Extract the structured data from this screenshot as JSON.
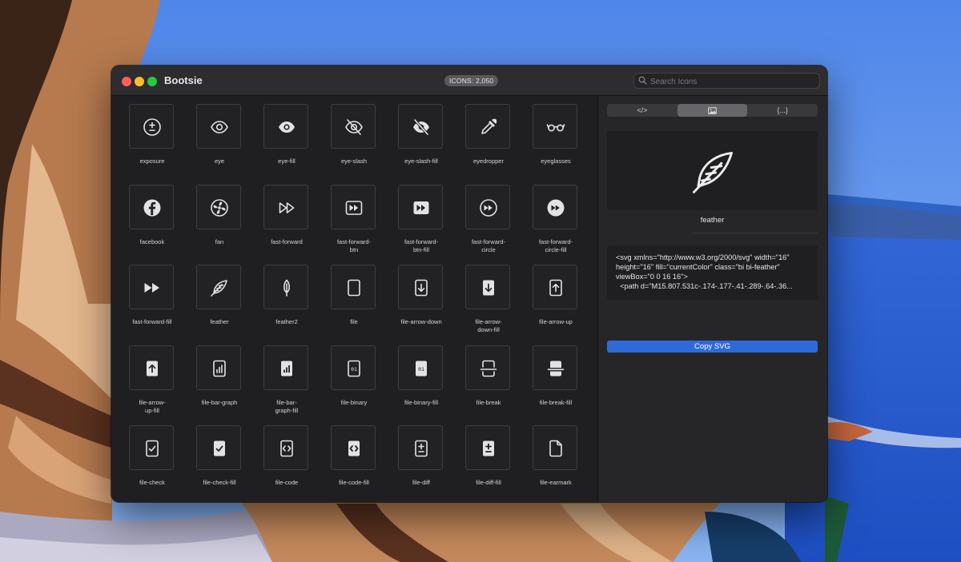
{
  "window": {
    "title": "Bootsie",
    "icon_count": "ICONS: 2,050"
  },
  "search": {
    "placeholder": "Search Icons",
    "value": ""
  },
  "grid": {
    "icons": [
      {
        "name": "exposure",
        "label": [
          "exposure"
        ],
        "icon": "exposure-icon"
      },
      {
        "name": "eye",
        "label": [
          "eye"
        ],
        "icon": "eye-icon"
      },
      {
        "name": "eye-fill",
        "label": [
          "eye-fill"
        ],
        "icon": "eye-fill-icon"
      },
      {
        "name": "eye-slash",
        "label": [
          "eye-slash"
        ],
        "icon": "eye-slash-icon"
      },
      {
        "name": "eye-slash-fill",
        "label": [
          "eye-slash-fill"
        ],
        "icon": "eye-slash-fill-icon"
      },
      {
        "name": "eyedropper",
        "label": [
          "eyedropper"
        ],
        "icon": "eyedropper-icon"
      },
      {
        "name": "eyeglasses",
        "label": [
          "eyeglasses"
        ],
        "icon": "eyeglasses-icon"
      },
      {
        "name": "facebook",
        "label": [
          "facebook"
        ],
        "icon": "facebook-icon"
      },
      {
        "name": "fan",
        "label": [
          "fan"
        ],
        "icon": "fan-icon"
      },
      {
        "name": "fast-forward",
        "label": [
          "fast-forward"
        ],
        "icon": "fast-forward-icon"
      },
      {
        "name": "fast-forward-btn",
        "label": [
          "fast-forward-",
          "btn"
        ],
        "icon": "fast-forward-btn-icon"
      },
      {
        "name": "fast-forward-btn-fill",
        "label": [
          "fast-forward-",
          "btn-fill"
        ],
        "icon": "fast-forward-btn-fill-icon"
      },
      {
        "name": "fast-forward-circle",
        "label": [
          "fast-forward-",
          "circle"
        ],
        "icon": "fast-forward-circle-icon"
      },
      {
        "name": "fast-forward-circle-fill",
        "label": [
          "fast-forward-",
          "circle-fill"
        ],
        "icon": "fast-forward-circle-fill-icon"
      },
      {
        "name": "fast-forward-fill",
        "label": [
          "fast-forward-fill"
        ],
        "icon": "fast-forward-fill-icon"
      },
      {
        "name": "feather",
        "label": [
          "feather"
        ],
        "icon": "feather-icon"
      },
      {
        "name": "feather2",
        "label": [
          "feather2"
        ],
        "icon": "feather2-icon"
      },
      {
        "name": "file",
        "label": [
          "file"
        ],
        "icon": "file-icon"
      },
      {
        "name": "file-arrow-down",
        "label": [
          "file-arrow-down"
        ],
        "icon": "file-arrow-down-icon"
      },
      {
        "name": "file-arrow-down-fill",
        "label": [
          "file-arrow-",
          "down-fill"
        ],
        "icon": "file-arrow-down-fill-icon"
      },
      {
        "name": "file-arrow-up",
        "label": [
          "file-arrow-up"
        ],
        "icon": "file-arrow-up-icon"
      },
      {
        "name": "file-arrow-up-fill",
        "label": [
          "file-arrow-",
          "up-fill"
        ],
        "icon": "file-arrow-up-fill-icon"
      },
      {
        "name": "file-bar-graph",
        "label": [
          "file-bar-graph"
        ],
        "icon": "file-bar-graph-icon"
      },
      {
        "name": "file-bar-graph-fill",
        "label": [
          "file-bar-",
          "graph-fill"
        ],
        "icon": "file-bar-graph-fill-icon"
      },
      {
        "name": "file-binary",
        "label": [
          "file-binary"
        ],
        "icon": "file-binary-icon"
      },
      {
        "name": "file-binary-fill",
        "label": [
          "file-binary-fill"
        ],
        "icon": "file-binary-fill-icon"
      },
      {
        "name": "file-break",
        "label": [
          "file-break"
        ],
        "icon": "file-break-icon"
      },
      {
        "name": "file-break-fill",
        "label": [
          "file-break-fill"
        ],
        "icon": "file-break-fill-icon"
      },
      {
        "name": "file-check",
        "label": [
          "file-check"
        ],
        "icon": "file-check-icon"
      },
      {
        "name": "file-check-fill",
        "label": [
          "file-check-fill"
        ],
        "icon": "file-check-fill-icon"
      },
      {
        "name": "file-code",
        "label": [
          "file-code"
        ],
        "icon": "file-code-icon"
      },
      {
        "name": "file-code-fill",
        "label": [
          "file-code-fill"
        ],
        "icon": "file-code-fill-icon"
      },
      {
        "name": "file-diff",
        "label": [
          "file-diff"
        ],
        "icon": "file-diff-icon"
      },
      {
        "name": "file-diff-fill",
        "label": [
          "file-diff-fill"
        ],
        "icon": "file-diff-fill-icon"
      },
      {
        "name": "file-earmark",
        "label": [
          "file-earmark"
        ],
        "icon": "file-earmark-icon"
      }
    ]
  },
  "detail": {
    "tabs": [
      {
        "name": "code",
        "label": "</>",
        "active": false
      },
      {
        "name": "image",
        "label": "",
        "icon": "image-icon",
        "active": true
      },
      {
        "name": "json",
        "label": "{...}",
        "active": false
      }
    ],
    "selected_name": "feather",
    "code_lines": [
      "<svg xmlns=\"http://www.w3.org/2000/svg\" width=\"16\"",
      "height=\"16\" fill=\"currentColor\" class=\"bi bi-feather\"",
      "viewBox=\"0 0 16 16\">",
      "  <path d=\"M15.807.531c-.174-.177-.41-.289-.64-.36..."
    ],
    "copy_label": "Copy SVG"
  },
  "colors": {
    "accent": "#2f6ad9",
    "window_bg": "#1f1f21",
    "close": "#fe5f57",
    "minimize": "#febc2e",
    "maximize": "#28c840"
  }
}
